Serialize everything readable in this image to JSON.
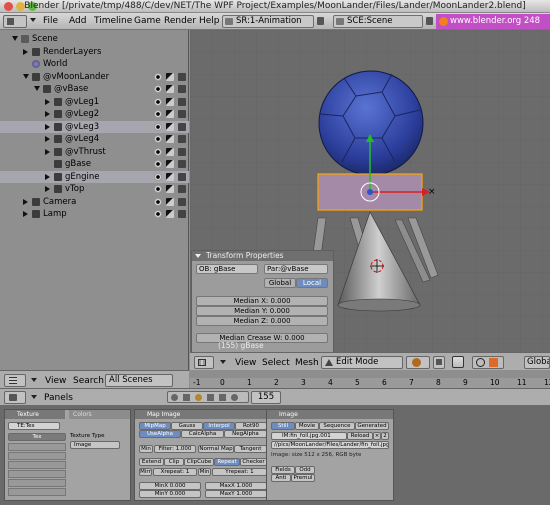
{
  "window": {
    "title": "Blender [/private/tmp/488/C/dev/NET/The WPF Project/Examples/MoonLander/Files/Lander/MoonLander2.blend]"
  },
  "menubar": {
    "menus": [
      "File",
      "Add",
      "Timeline",
      "Game",
      "Render",
      "Help"
    ],
    "screen_field": "SR:1-Animation",
    "scene_field": "SCE:Scene",
    "link_text": "www.blender.org 248"
  },
  "outliner": {
    "rows": [
      {
        "label": "Scene",
        "indent": 0,
        "expanded": true
      },
      {
        "label": "RenderLayers",
        "indent": 1,
        "expanded": false
      },
      {
        "label": "World",
        "indent": 1,
        "expanded": null
      },
      {
        "label": "@vMoonLander",
        "indent": 1,
        "expanded": true
      },
      {
        "label": "@vBase",
        "indent": 2,
        "expanded": true
      },
      {
        "label": "@vLeg1",
        "indent": 3,
        "expanded": false
      },
      {
        "label": "@vLeg2",
        "indent": 3,
        "expanded": false
      },
      {
        "label": "@vLeg3",
        "indent": 3,
        "expanded": false
      },
      {
        "label": "@vLeg4",
        "indent": 3,
        "expanded": false
      },
      {
        "label": "@vThrust",
        "indent": 3,
        "expanded": false
      },
      {
        "label": "gBase",
        "indent": 3,
        "expanded": null
      },
      {
        "label": "gEngine",
        "indent": 3,
        "expanded": false
      },
      {
        "label": "vTop",
        "indent": 3,
        "expanded": false
      },
      {
        "label": "Camera",
        "indent": 1,
        "expanded": false
      },
      {
        "label": "Lamp",
        "indent": 1,
        "expanded": false
      }
    ],
    "header": {
      "view_menu": "View",
      "search_menu": "Search",
      "scenes_select": "All Scenes"
    }
  },
  "transform_panel": {
    "title": "Transform Properties",
    "ob_field": "OB: gBase",
    "par_field": "Par:@vBase",
    "global_label": "Global",
    "local_label": "Local",
    "median_x": "Median X: 0.000",
    "median_y": "Median Y: 0.000",
    "median_z": "Median Z: 0.000",
    "median_crease": "Median Crease W: 0.000",
    "footer": "(155) gBase"
  },
  "view_header": {
    "view": "View",
    "select": "Select",
    "mesh": "Mesh",
    "mode": "Edit Mode",
    "orientation": "Globa"
  },
  "timeline": {
    "ticks": [
      "-1",
      "0",
      "1",
      "2",
      "3",
      "4",
      "5",
      "6",
      "7",
      "8",
      "9",
      "10",
      "11",
      "12"
    ],
    "frame": "155"
  },
  "buttons": {
    "panels_label": "Panels",
    "texture_panel": {
      "title": "Texture",
      "tab": "Colors",
      "te_field": "TE:Tex",
      "tex_item": "Tex",
      "type_label": "Texture Type",
      "type_value": "Image"
    },
    "map_image_panel": {
      "title": "Map Image",
      "row1": [
        "MipMap",
        "Gauss",
        "Interpol",
        "Rot90"
      ],
      "row2": [
        "UseAlpha",
        "CalcAlpha",
        "NegAlpha"
      ],
      "min": "Min",
      "filter": "Filter: 1.000",
      "normal_map": "Normal Map",
      "tangent": "Tangent",
      "row4": [
        "Extend",
        "Clip",
        "ClipCube",
        "Repeat",
        "Checker"
      ],
      "mirr": "Mirr",
      "xrepeat": "Xrepeat: 1",
      "min2": "Min",
      "yrepeat": "Yrepeat: 1",
      "minx": "MinX 0.000",
      "maxx": "MaxX 1.000",
      "miny": "MinY 0.000",
      "maxy": "MaxY 1.000"
    },
    "image_panel": {
      "title": "Image",
      "tabs": [
        "Still",
        "Movie",
        "Sequence",
        "Generated"
      ],
      "file_field": "IM:fin_foil.jpg.001",
      "reload": "Reload",
      "path": "//pics/MoonLander/Files/Lander/fin_foil.jpg",
      "info": "Image: size 512 x 256, RGB byte",
      "fields": "Fields",
      "odd": "Odd",
      "antl": "Anti",
      "premul": "Premul"
    }
  },
  "colors": {
    "link_bg": "#c34fc6",
    "sphere": "#2e3f9c",
    "selection": "#ffa500",
    "active_button": "#6d8cc0"
  }
}
